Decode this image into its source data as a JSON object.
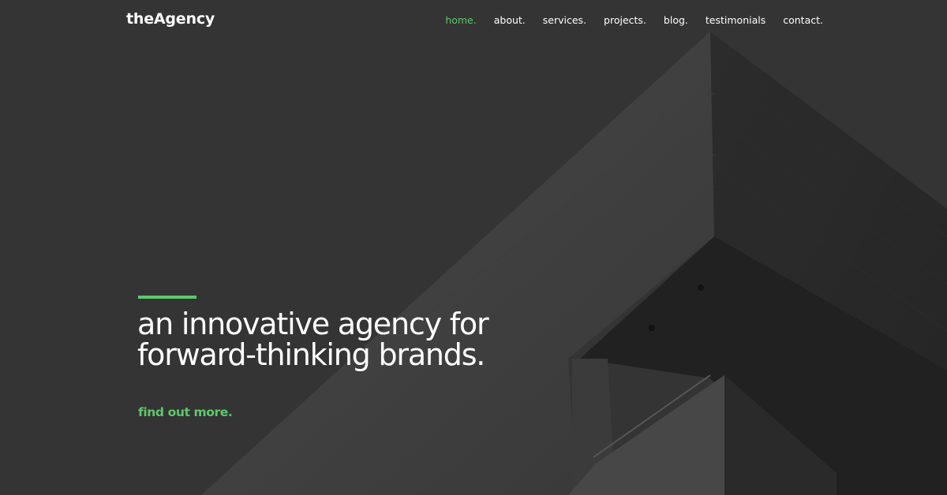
{
  "brand": {
    "logo": "theAgency"
  },
  "nav": {
    "items": [
      {
        "label": "home.",
        "active": true
      },
      {
        "label": "about.",
        "active": false
      },
      {
        "label": "services.",
        "active": false
      },
      {
        "label": "projects.",
        "active": false
      },
      {
        "label": "blog.",
        "active": false
      },
      {
        "label": "testimonials",
        "active": false
      },
      {
        "label": "contact.",
        "active": false
      }
    ]
  },
  "hero": {
    "headline_line1": "an innovative agency for",
    "headline_line2": "forward-thinking brands.",
    "cta_label": "find out more."
  },
  "colors": {
    "accent": "#5cc96b",
    "background": "#353535",
    "text": "#ffffff"
  }
}
